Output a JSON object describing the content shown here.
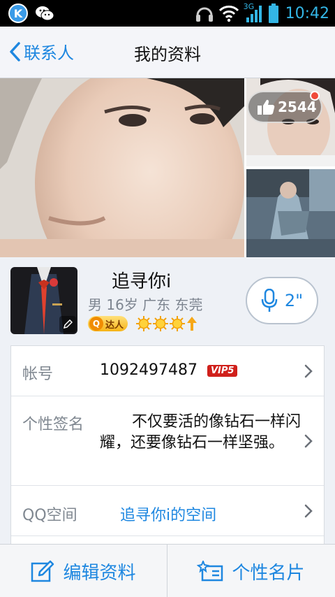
{
  "status_bar": {
    "time": "10:42",
    "network": "3G",
    "left_icons": [
      "k-app-icon",
      "wechat-icon"
    ],
    "right_icons": [
      "headset-icon",
      "wifi-icon",
      "signal-icon",
      "battery-icon"
    ]
  },
  "nav": {
    "back_label": "联系人",
    "title": "我的资料"
  },
  "photos": {
    "like_count": "2544"
  },
  "profile": {
    "nickname": "追寻你i",
    "meta": "男 16岁 广东 东莞",
    "daren_label": "达人",
    "level_icons": [
      "sun-icon",
      "sun-icon",
      "sun-icon",
      "up-arrow-icon"
    ],
    "voice_duration": "2\""
  },
  "info": {
    "account_label": "帐号",
    "account_value": "1092497487",
    "vip_badge": "VIP5",
    "signature_label": "个性签名",
    "signature_value": "不仅要活的像钻石一样闪耀，还要像钻石一样坚强。",
    "qzone_label": "QQ空间",
    "qzone_value": "追寻你i的空间"
  },
  "bottom": {
    "edit_label": "编辑资料",
    "card_label": "个性名片"
  },
  "colors": {
    "accent": "#1e87e0",
    "status_time": "#33b5e5",
    "vip_red": "#d0201b"
  }
}
